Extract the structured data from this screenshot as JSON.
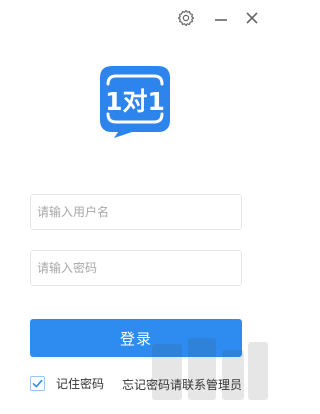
{
  "window": {
    "settings_icon": "gear-icon",
    "minimize_icon": "minimize-icon",
    "close_icon": "close-icon"
  },
  "logo": {
    "text": "1对1",
    "color": "#2d84ec"
  },
  "form": {
    "username_placeholder": "请输入用户名",
    "username_value": "",
    "password_placeholder": "请输入密码",
    "password_value": ""
  },
  "login_label": "登录",
  "remember": {
    "label": "记住密码",
    "checked": true
  },
  "forgot_text": "忘记密码请联系管理员",
  "colors": {
    "primary": "#2e8cf0",
    "border": "#e6e6e6",
    "placeholder": "#a8a8a8"
  }
}
